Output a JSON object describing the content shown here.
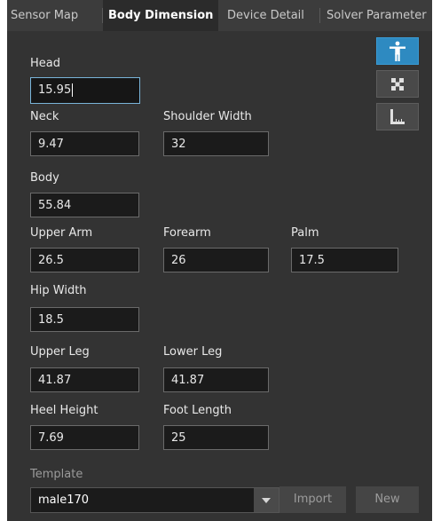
{
  "tabs": [
    {
      "label": "Sensor Map"
    },
    {
      "label": "Body Dimension"
    },
    {
      "label": "Device Detail"
    },
    {
      "label": "Solver Parameter"
    }
  ],
  "side_buttons": [
    {
      "icon": "human-figure-icon",
      "active": true
    },
    {
      "icon": "grid-pattern-icon",
      "active": false
    },
    {
      "icon": "ruler-icon",
      "active": false
    }
  ],
  "fields": {
    "head": {
      "label": "Head",
      "value": "15.95"
    },
    "neck": {
      "label": "Neck",
      "value": "9.47"
    },
    "shoulder_width": {
      "label": "Shoulder Width",
      "value": "32"
    },
    "body": {
      "label": "Body",
      "value": "55.84"
    },
    "upper_arm": {
      "label": "Upper Arm",
      "value": "26.5"
    },
    "forearm": {
      "label": "Forearm",
      "value": "26"
    },
    "palm": {
      "label": "Palm",
      "value": "17.5"
    },
    "hip_width": {
      "label": "Hip Width",
      "value": "18.5"
    },
    "upper_leg": {
      "label": "Upper Leg",
      "value": "41.87"
    },
    "lower_leg": {
      "label": "Lower Leg",
      "value": "41.87"
    },
    "heel_height": {
      "label": "Heel Height",
      "value": "7.69"
    },
    "foot_length": {
      "label": "Foot Length",
      "value": "25"
    }
  },
  "template": {
    "label": "Template",
    "selected": "male170",
    "import_label": "Import",
    "new_label": "New"
  },
  "colors": {
    "panel": "#333333",
    "accent": "#2e8ac1",
    "focus_border": "#79b4d9"
  }
}
